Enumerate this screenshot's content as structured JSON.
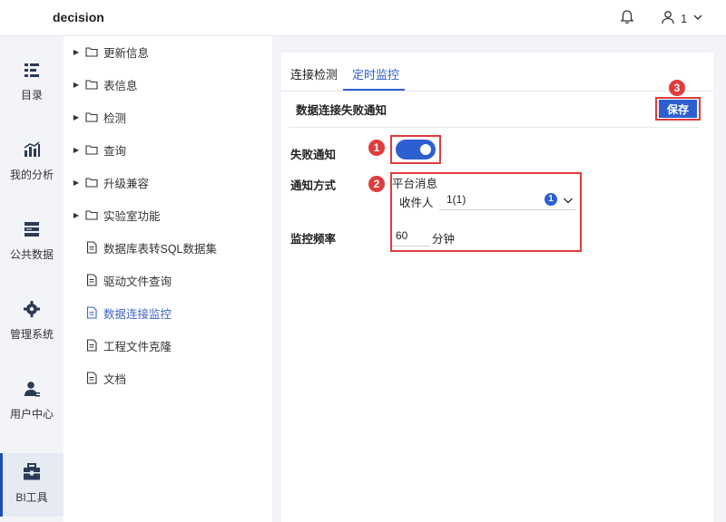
{
  "header": {
    "app_title": "decision",
    "user_name": "1"
  },
  "nav": {
    "items": [
      {
        "label": "目录",
        "icon": "catalog-icon"
      },
      {
        "label": "我的分析",
        "icon": "analysis-chart-icon"
      },
      {
        "label": "公共数据",
        "icon": "database-icon"
      },
      {
        "label": "管理系统",
        "icon": "gear-icon"
      },
      {
        "label": "用户中心",
        "icon": "user-icon"
      },
      {
        "label": "BI工具",
        "icon": "toolbox-icon",
        "active": true
      }
    ]
  },
  "tree": {
    "items": [
      {
        "label": "更新信息",
        "type": "folder"
      },
      {
        "label": "表信息",
        "type": "folder"
      },
      {
        "label": "检测",
        "type": "folder"
      },
      {
        "label": "查询",
        "type": "folder"
      },
      {
        "label": "升级兼容",
        "type": "folder"
      },
      {
        "label": "实验室功能",
        "type": "folder"
      },
      {
        "label": "数据库表转SQL数据集",
        "type": "document"
      },
      {
        "label": "驱动文件查询",
        "type": "document"
      },
      {
        "label": "数据连接监控",
        "type": "document",
        "active": true
      },
      {
        "label": "工程文件克隆",
        "type": "document"
      },
      {
        "label": "文档",
        "type": "document"
      }
    ]
  },
  "main": {
    "tabs": [
      {
        "label": "连接检测"
      },
      {
        "label": "定时监控",
        "active": true
      }
    ],
    "section_title": "数据连接失败通知",
    "save_label": "保存",
    "form": {
      "failure_notice_label": "失败通知",
      "failure_notice_enabled": true,
      "notify_method_label": "通知方式",
      "notify_method_value": "平台消息",
      "recipient_label": "收件人",
      "recipient_value": "1(1)",
      "recipient_count": "1",
      "frequency_label": "监控频率",
      "frequency_value": "60",
      "frequency_unit": "分钟"
    },
    "markers": [
      "1",
      "2",
      "3"
    ]
  },
  "colors": {
    "accent": "#2d5fd1",
    "highlight": "#e03c3c",
    "nav_active_bg": "#e6ebf3"
  }
}
